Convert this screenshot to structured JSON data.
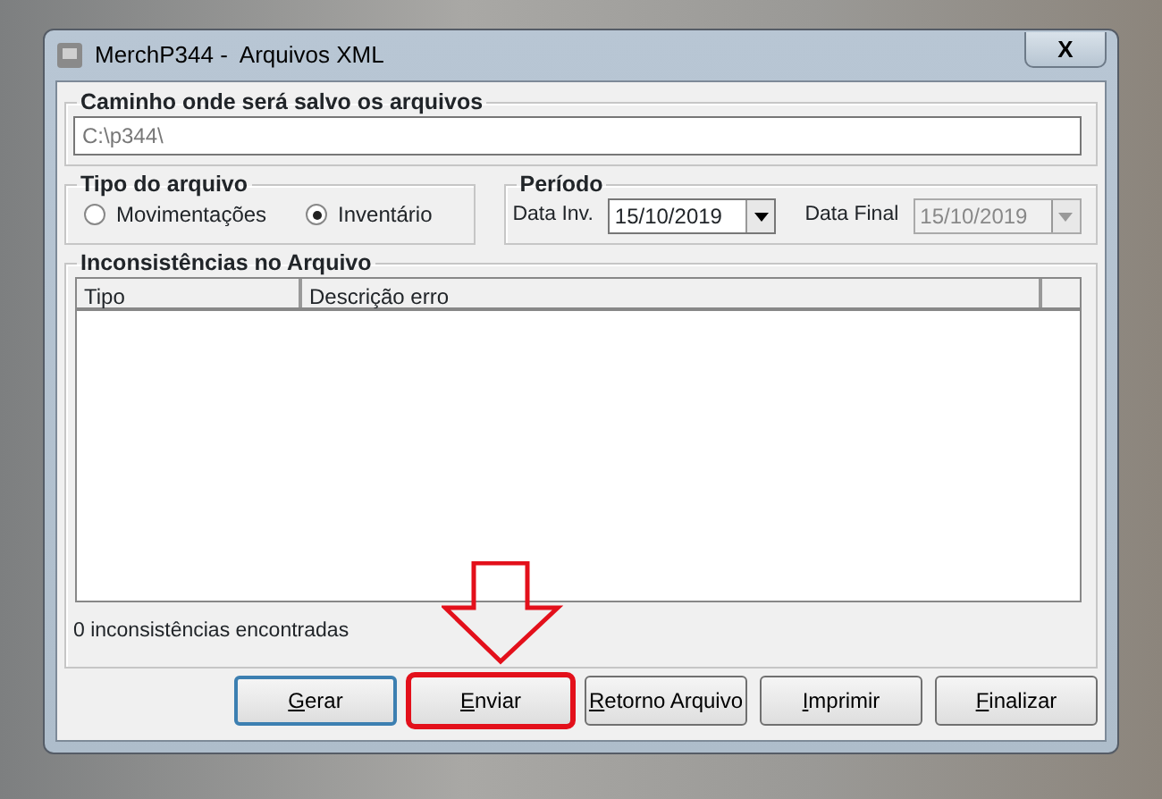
{
  "window": {
    "title": "MerchP344 -  Arquivos XML",
    "close": "X"
  },
  "path_group": {
    "title": "Caminho onde será salvo os arquivos",
    "value": "C:\\p344\\"
  },
  "file_type": {
    "title": "Tipo do arquivo",
    "options": [
      {
        "label": "Movimentações",
        "selected": false
      },
      {
        "label": "Inventário",
        "selected": true
      }
    ]
  },
  "period": {
    "title": "Período",
    "fields": [
      {
        "label": "Data Inv.",
        "value": "15/10/2019",
        "disabled": false
      },
      {
        "label": "Data Final",
        "value": "15/10/2019",
        "disabled": true
      }
    ]
  },
  "inconsistencies": {
    "title": "Inconsistências no Arquivo",
    "columns": [
      "Tipo",
      "Descrição erro"
    ],
    "status": "0 inconsistências encontradas"
  },
  "buttons": [
    {
      "label": "Gerar",
      "highlighted": false,
      "default": true
    },
    {
      "label": "Enviar",
      "highlighted": true,
      "default": false
    },
    {
      "label": "Retorno Arquivo",
      "highlighted": false,
      "default": false
    },
    {
      "label": "Imprimir",
      "highlighted": false,
      "default": false
    },
    {
      "label": "Finalizar",
      "highlighted": false,
      "default": false
    }
  ],
  "annotation": {
    "kind": "arrow"
  }
}
